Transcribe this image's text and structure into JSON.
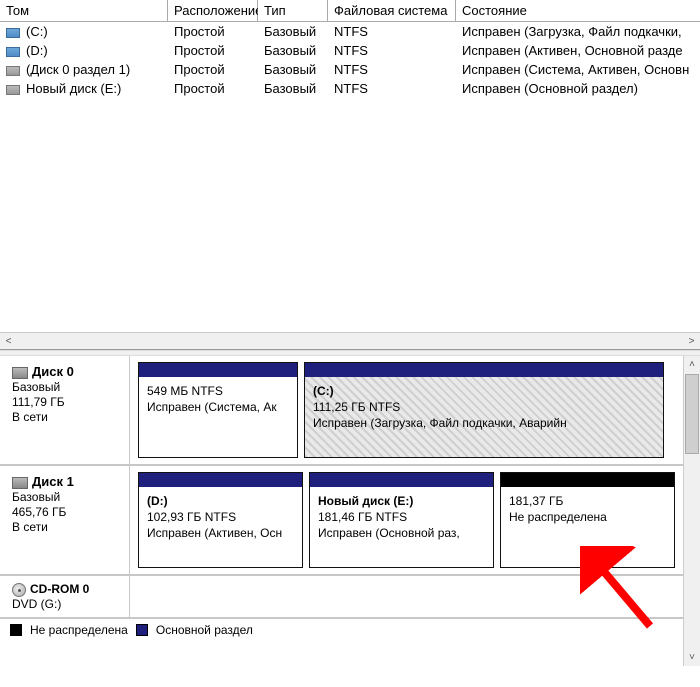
{
  "columns": {
    "tom": "Том",
    "loc": "Расположение",
    "type": "Тип",
    "fs": "Файловая система",
    "status": "Состояние"
  },
  "volumes": [
    {
      "icon": "blue",
      "name": "(C:)",
      "loc": "Простой",
      "type": "Базовый",
      "fs": "NTFS",
      "status": "Исправен (Загрузка, Файл подкачки,"
    },
    {
      "icon": "blue",
      "name": "(D:)",
      "loc": "Простой",
      "type": "Базовый",
      "fs": "NTFS",
      "status": "Исправен (Активен, Основной разде"
    },
    {
      "icon": "gray",
      "name": "(Диск 0 раздел 1)",
      "loc": "Простой",
      "type": "Базовый",
      "fs": "NTFS",
      "status": "Исправен (Система, Активен, Основн"
    },
    {
      "icon": "gray",
      "name": "Новый диск (E:)",
      "loc": "Простой",
      "type": "Базовый",
      "fs": "NTFS",
      "status": "Исправен (Основной раздел)"
    }
  ],
  "disks": [
    {
      "name": "Диск 0",
      "type": "Базовый",
      "size": "111,79 ГБ",
      "status": "В сети",
      "parts": [
        {
          "bar": "navy",
          "hatched": false,
          "title": "",
          "size": "549 МБ NTFS",
          "status": "Исправен (Система, Ак",
          "flex": 160
        },
        {
          "bar": "navy",
          "hatched": true,
          "title": "(C:)",
          "size": "111,25 ГБ NTFS",
          "status": "Исправен (Загрузка, Файл подкачки, Аварийн",
          "flex": 360
        }
      ]
    },
    {
      "name": "Диск 1",
      "type": "Базовый",
      "size": "465,76 ГБ",
      "status": "В сети",
      "parts": [
        {
          "bar": "navy",
          "hatched": false,
          "title": "(D:)",
          "size": "102,93 ГБ NTFS",
          "status": "Исправен (Активен, Осн",
          "flex": 165
        },
        {
          "bar": "navy",
          "hatched": false,
          "title": "Новый диск  (E:)",
          "size": "181,46 ГБ NTFS",
          "status": "Исправен (Основной раз,",
          "flex": 185
        },
        {
          "bar": "black",
          "hatched": false,
          "title": "",
          "size": "181,37 ГБ",
          "status": "Не распределена",
          "flex": 175
        }
      ]
    }
  ],
  "cd": {
    "name": "CD-ROM 0",
    "sub": "DVD (G:)"
  },
  "legend": {
    "unalloc": "Не распределена",
    "primary": "Основной раздел"
  }
}
